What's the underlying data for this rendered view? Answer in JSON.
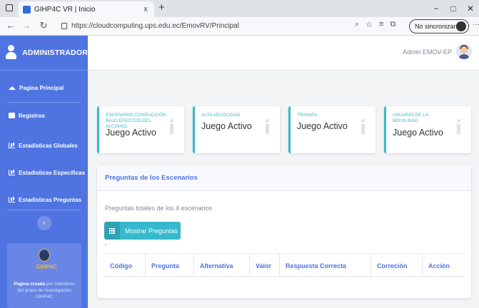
{
  "browser": {
    "tab_title": "GIHP4C VR | Inicio",
    "tab_close": "x",
    "new_tab": "+",
    "url": "https://cloudcomputing.ups.edu.ec/EmovRV/Principal",
    "sync_label": "No sincronizando",
    "more": "···",
    "win_min": "−",
    "win_max": "□",
    "win_close": "✕"
  },
  "sidebar": {
    "title": "ADMINISTRADOR",
    "items": [
      {
        "label": "Pagina Principal",
        "icon": "home-icon"
      },
      {
        "label": "Registros",
        "icon": "folder-icon"
      },
      {
        "label": "Estadisticas Globales",
        "icon": "chart-icon"
      },
      {
        "label": "Estadisticas Especificas",
        "icon": "chart-icon"
      },
      {
        "label": "Estadisticas Preguntas",
        "icon": "chart-icon"
      }
    ],
    "collapse_glyph": "‹",
    "footer": {
      "logo_text": "GIHP4C",
      "line1_bold": "Pagina creada",
      "line1_rest": " por miembros",
      "line2": "del grupo de investigacion",
      "line3": "GIHP4C"
    }
  },
  "topbar": {
    "user_name": "Admin EMOV-EP"
  },
  "cards": [
    {
      "label": "ESCENARIO CONDUCCIÓN BAJO EFECTOS DEL ALCOHOL",
      "value": "Juego Activo"
    },
    {
      "label": "ALTA VELOCIDAD",
      "value": "Juego Activo"
    },
    {
      "label": "TRANVÍA",
      "value": "Juego Activo"
    },
    {
      "label": "USUARIO DE LA MOVILIDAD",
      "value": "Juego Activo"
    }
  ],
  "panel": {
    "title": "Preguntas de los Escenarios",
    "subtitle": "Preguntas totales de los 4 escenarios",
    "button": "Mostrar Preguntas",
    "columns": [
      "Código",
      "Pregunta",
      "Alternativa",
      "Valor",
      "Respuesta Correcta",
      "Correción",
      "Acción"
    ]
  }
}
